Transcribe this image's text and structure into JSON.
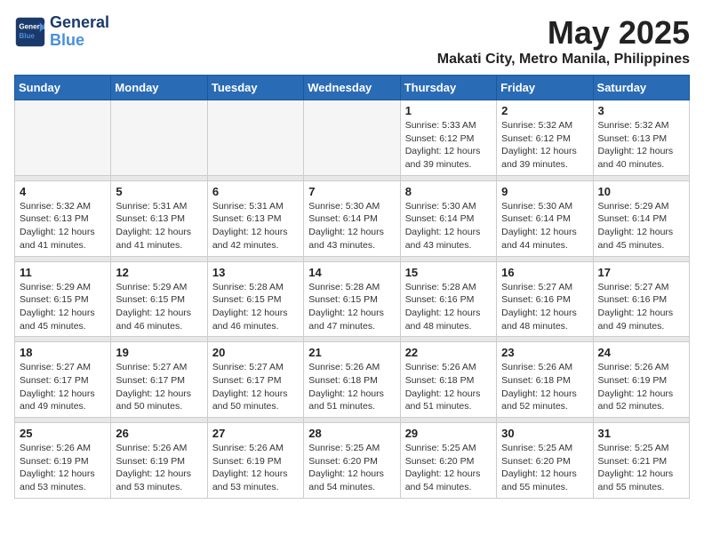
{
  "logo": {
    "text_general": "General",
    "text_blue": "Blue"
  },
  "title": "May 2025",
  "subtitle": "Makati City, Metro Manila, Philippines",
  "days_of_week": [
    "Sunday",
    "Monday",
    "Tuesday",
    "Wednesday",
    "Thursday",
    "Friday",
    "Saturday"
  ],
  "weeks": [
    [
      {
        "day": "",
        "info": ""
      },
      {
        "day": "",
        "info": ""
      },
      {
        "day": "",
        "info": ""
      },
      {
        "day": "",
        "info": ""
      },
      {
        "day": "1",
        "info": "Sunrise: 5:33 AM\nSunset: 6:12 PM\nDaylight: 12 hours\nand 39 minutes."
      },
      {
        "day": "2",
        "info": "Sunrise: 5:32 AM\nSunset: 6:12 PM\nDaylight: 12 hours\nand 39 minutes."
      },
      {
        "day": "3",
        "info": "Sunrise: 5:32 AM\nSunset: 6:13 PM\nDaylight: 12 hours\nand 40 minutes."
      }
    ],
    [
      {
        "day": "4",
        "info": "Sunrise: 5:32 AM\nSunset: 6:13 PM\nDaylight: 12 hours\nand 41 minutes."
      },
      {
        "day": "5",
        "info": "Sunrise: 5:31 AM\nSunset: 6:13 PM\nDaylight: 12 hours\nand 41 minutes."
      },
      {
        "day": "6",
        "info": "Sunrise: 5:31 AM\nSunset: 6:13 PM\nDaylight: 12 hours\nand 42 minutes."
      },
      {
        "day": "7",
        "info": "Sunrise: 5:30 AM\nSunset: 6:14 PM\nDaylight: 12 hours\nand 43 minutes."
      },
      {
        "day": "8",
        "info": "Sunrise: 5:30 AM\nSunset: 6:14 PM\nDaylight: 12 hours\nand 43 minutes."
      },
      {
        "day": "9",
        "info": "Sunrise: 5:30 AM\nSunset: 6:14 PM\nDaylight: 12 hours\nand 44 minutes."
      },
      {
        "day": "10",
        "info": "Sunrise: 5:29 AM\nSunset: 6:14 PM\nDaylight: 12 hours\nand 45 minutes."
      }
    ],
    [
      {
        "day": "11",
        "info": "Sunrise: 5:29 AM\nSunset: 6:15 PM\nDaylight: 12 hours\nand 45 minutes."
      },
      {
        "day": "12",
        "info": "Sunrise: 5:29 AM\nSunset: 6:15 PM\nDaylight: 12 hours\nand 46 minutes."
      },
      {
        "day": "13",
        "info": "Sunrise: 5:28 AM\nSunset: 6:15 PM\nDaylight: 12 hours\nand 46 minutes."
      },
      {
        "day": "14",
        "info": "Sunrise: 5:28 AM\nSunset: 6:15 PM\nDaylight: 12 hours\nand 47 minutes."
      },
      {
        "day": "15",
        "info": "Sunrise: 5:28 AM\nSunset: 6:16 PM\nDaylight: 12 hours\nand 48 minutes."
      },
      {
        "day": "16",
        "info": "Sunrise: 5:27 AM\nSunset: 6:16 PM\nDaylight: 12 hours\nand 48 minutes."
      },
      {
        "day": "17",
        "info": "Sunrise: 5:27 AM\nSunset: 6:16 PM\nDaylight: 12 hours\nand 49 minutes."
      }
    ],
    [
      {
        "day": "18",
        "info": "Sunrise: 5:27 AM\nSunset: 6:17 PM\nDaylight: 12 hours\nand 49 minutes."
      },
      {
        "day": "19",
        "info": "Sunrise: 5:27 AM\nSunset: 6:17 PM\nDaylight: 12 hours\nand 50 minutes."
      },
      {
        "day": "20",
        "info": "Sunrise: 5:27 AM\nSunset: 6:17 PM\nDaylight: 12 hours\nand 50 minutes."
      },
      {
        "day": "21",
        "info": "Sunrise: 5:26 AM\nSunset: 6:18 PM\nDaylight: 12 hours\nand 51 minutes."
      },
      {
        "day": "22",
        "info": "Sunrise: 5:26 AM\nSunset: 6:18 PM\nDaylight: 12 hours\nand 51 minutes."
      },
      {
        "day": "23",
        "info": "Sunrise: 5:26 AM\nSunset: 6:18 PM\nDaylight: 12 hours\nand 52 minutes."
      },
      {
        "day": "24",
        "info": "Sunrise: 5:26 AM\nSunset: 6:19 PM\nDaylight: 12 hours\nand 52 minutes."
      }
    ],
    [
      {
        "day": "25",
        "info": "Sunrise: 5:26 AM\nSunset: 6:19 PM\nDaylight: 12 hours\nand 53 minutes."
      },
      {
        "day": "26",
        "info": "Sunrise: 5:26 AM\nSunset: 6:19 PM\nDaylight: 12 hours\nand 53 minutes."
      },
      {
        "day": "27",
        "info": "Sunrise: 5:26 AM\nSunset: 6:19 PM\nDaylight: 12 hours\nand 53 minutes."
      },
      {
        "day": "28",
        "info": "Sunrise: 5:25 AM\nSunset: 6:20 PM\nDaylight: 12 hours\nand 54 minutes."
      },
      {
        "day": "29",
        "info": "Sunrise: 5:25 AM\nSunset: 6:20 PM\nDaylight: 12 hours\nand 54 minutes."
      },
      {
        "day": "30",
        "info": "Sunrise: 5:25 AM\nSunset: 6:20 PM\nDaylight: 12 hours\nand 55 minutes."
      },
      {
        "day": "31",
        "info": "Sunrise: 5:25 AM\nSunset: 6:21 PM\nDaylight: 12 hours\nand 55 minutes."
      }
    ]
  ]
}
